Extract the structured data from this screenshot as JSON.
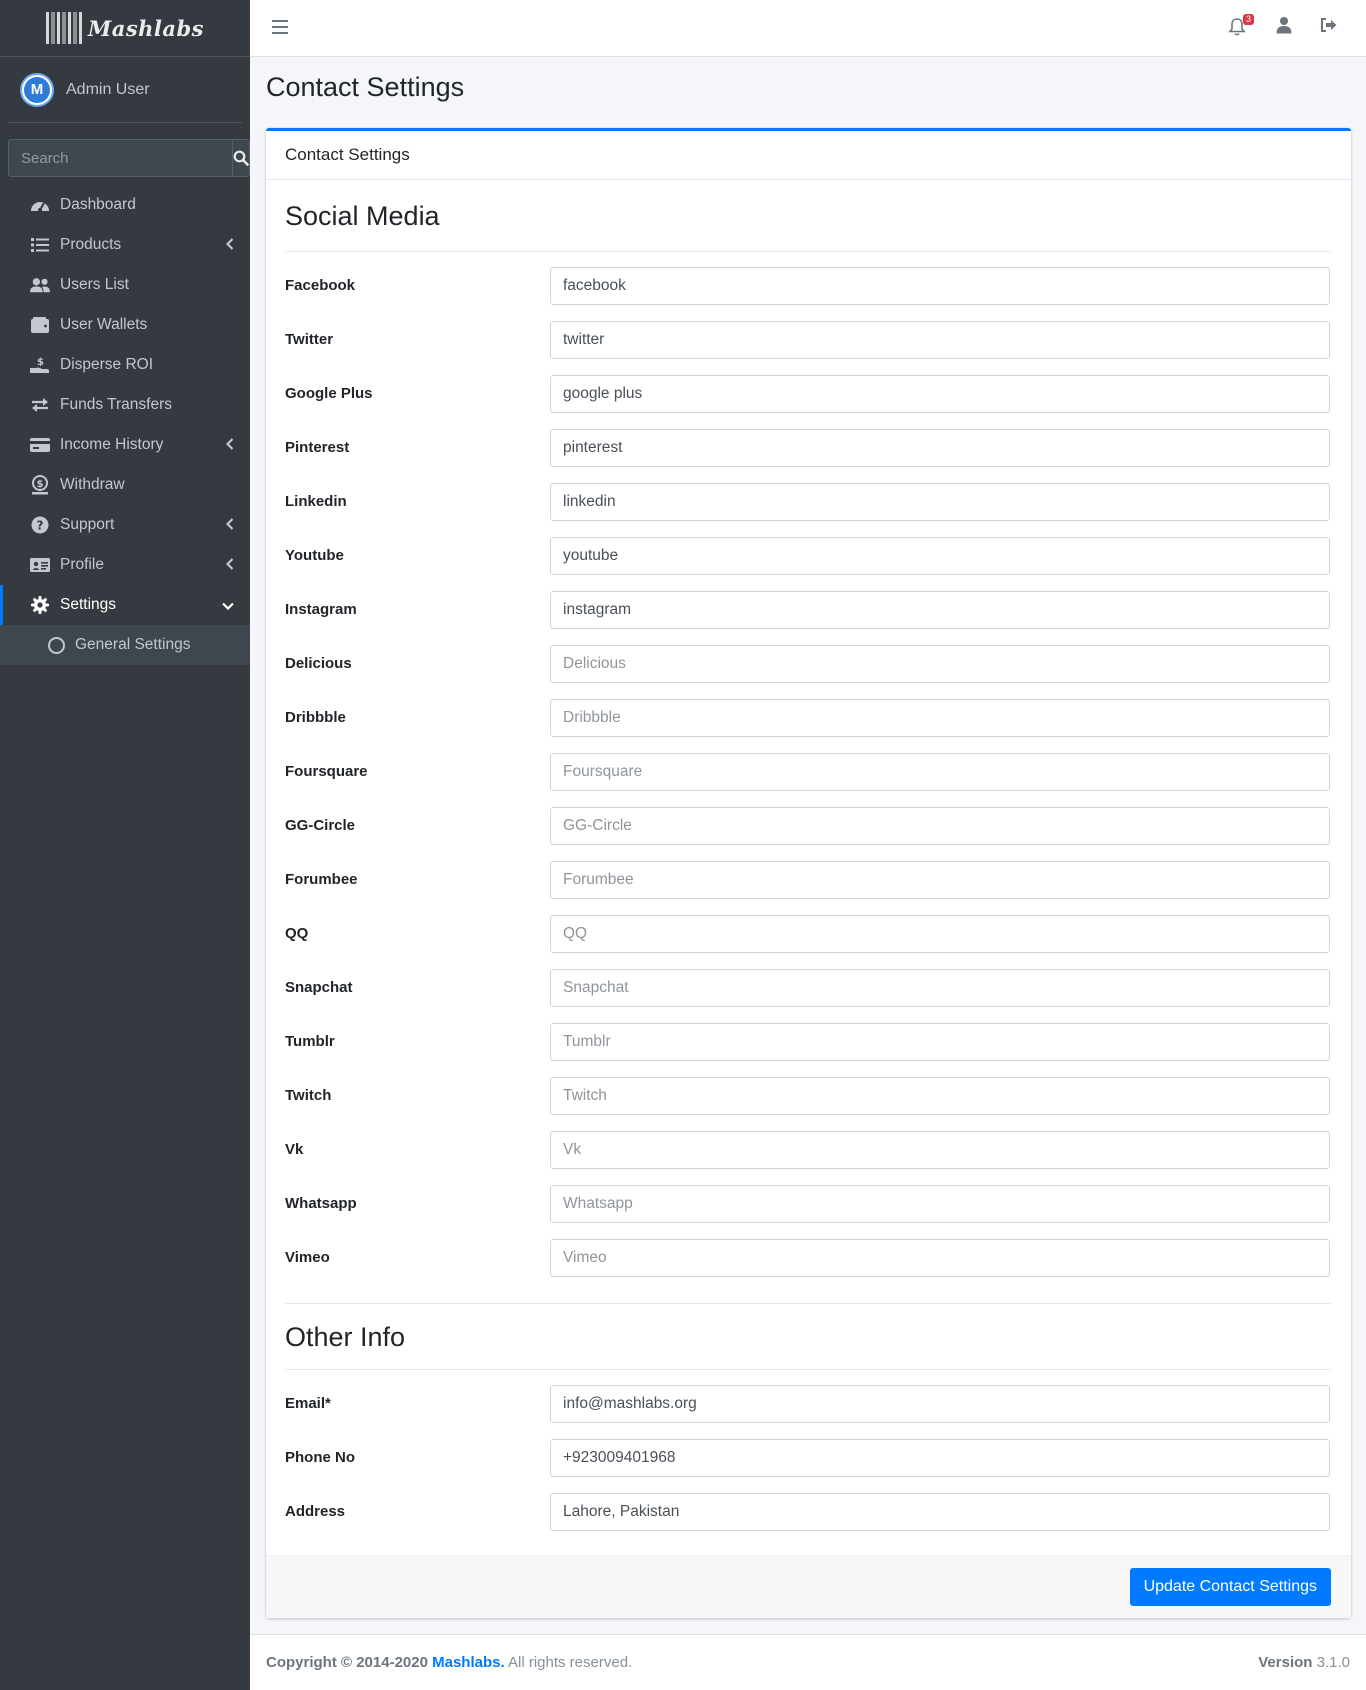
{
  "brand": {
    "name": "Mashlabs"
  },
  "user": {
    "name": "Admin User",
    "avatar_letter": "M"
  },
  "search": {
    "placeholder": "Search"
  },
  "sidebar": {
    "items": [
      {
        "label": "Dashboard",
        "icon": "dashboard-icon",
        "has_children": false
      },
      {
        "label": "Products",
        "icon": "list-icon",
        "has_children": true
      },
      {
        "label": "Users List",
        "icon": "users-icon",
        "has_children": false
      },
      {
        "label": "User Wallets",
        "icon": "wallet-icon",
        "has_children": false
      },
      {
        "label": "Disperse ROI",
        "icon": "hand-money-icon",
        "has_children": false
      },
      {
        "label": "Funds Transfers",
        "icon": "exchange-icon",
        "has_children": false
      },
      {
        "label": "Income History",
        "icon": "credit-card-icon",
        "has_children": true
      },
      {
        "label": "Withdraw",
        "icon": "dollar-icon",
        "has_children": false
      },
      {
        "label": "Support",
        "icon": "question-icon",
        "has_children": true
      },
      {
        "label": "Profile",
        "icon": "id-card-icon",
        "has_children": true
      },
      {
        "label": "Settings",
        "icon": "gear-icon",
        "has_children": true,
        "active": true
      }
    ],
    "subitems": [
      {
        "label": "General Settings"
      }
    ]
  },
  "topnav": {
    "notification_count": "3"
  },
  "page": {
    "title": "Contact Settings"
  },
  "card": {
    "header": "Contact Settings",
    "social_title": "Social Media",
    "other_title": "Other Info",
    "social_fields": [
      {
        "label": "Facebook",
        "value": "facebook",
        "placeholder": "Facebook"
      },
      {
        "label": "Twitter",
        "value": "twitter",
        "placeholder": "Twitter"
      },
      {
        "label": "Google Plus",
        "value": "google plus",
        "placeholder": "Google Plus"
      },
      {
        "label": "Pinterest",
        "value": "pinterest",
        "placeholder": "Pinterest"
      },
      {
        "label": "Linkedin",
        "value": "linkedin",
        "placeholder": "Linkedin"
      },
      {
        "label": "Youtube",
        "value": "youtube",
        "placeholder": "Youtube"
      },
      {
        "label": "Instagram",
        "value": "instagram",
        "placeholder": "Instagram"
      },
      {
        "label": "Delicious",
        "value": "",
        "placeholder": "Delicious"
      },
      {
        "label": "Dribbble",
        "value": "",
        "placeholder": "Dribbble"
      },
      {
        "label": "Foursquare",
        "value": "",
        "placeholder": "Foursquare"
      },
      {
        "label": "GG-Circle",
        "value": "",
        "placeholder": "GG-Circle"
      },
      {
        "label": "Forumbee",
        "value": "",
        "placeholder": "Forumbee"
      },
      {
        "label": "QQ",
        "value": "",
        "placeholder": "QQ"
      },
      {
        "label": "Snapchat",
        "value": "",
        "placeholder": "Snapchat"
      },
      {
        "label": "Tumblr",
        "value": "",
        "placeholder": "Tumblr"
      },
      {
        "label": "Twitch",
        "value": "",
        "placeholder": "Twitch"
      },
      {
        "label": "Vk",
        "value": "",
        "placeholder": "Vk"
      },
      {
        "label": "Whatsapp",
        "value": "",
        "placeholder": "Whatsapp"
      },
      {
        "label": "Vimeo",
        "value": "",
        "placeholder": "Vimeo"
      }
    ],
    "other_fields": [
      {
        "label": "Email*",
        "value": "info@mashlabs.org",
        "placeholder": "Email"
      },
      {
        "label": "Phone No",
        "value": "+923009401968",
        "placeholder": "Phone No"
      },
      {
        "label": "Address",
        "value": "Lahore, Pakistan",
        "placeholder": "Address"
      }
    ],
    "submit_label": "Update Contact Settings"
  },
  "footer": {
    "copyright": "Copyright © 2014-2020",
    "company": "Mashlabs.",
    "rights": "All rights reserved.",
    "version_label": "Version",
    "version": "3.1.0"
  },
  "colors": {
    "primary": "#007bff",
    "sidebar": "#343a40",
    "badge": "#dc3545"
  }
}
